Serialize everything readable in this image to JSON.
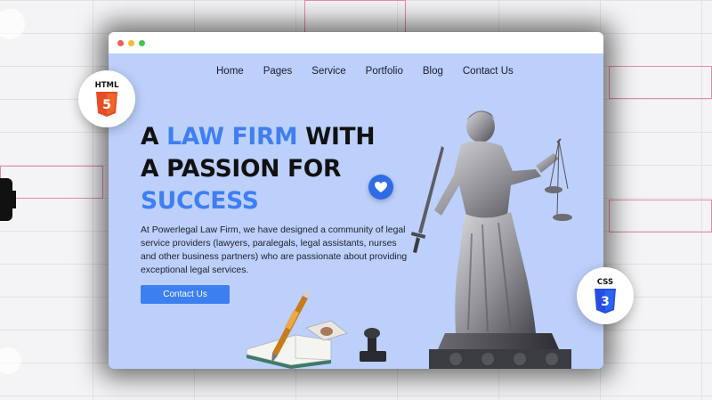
{
  "window": {
    "dots": [
      "close",
      "minimize",
      "maximize"
    ]
  },
  "nav": {
    "items": [
      "Home",
      "Pages",
      "Service",
      "Portfolio",
      "Blog",
      "Contact Us"
    ]
  },
  "hero": {
    "title_part1": "A ",
    "title_accent1": "LAW FIRM",
    "title_part2": " WITH",
    "title_line2": "A PASSION FOR",
    "title_accent2": "SUCCESS",
    "description": "At Powerlegal Law Firm, we have designed a community of legal service providers (lawyers, paralegals, legal assistants, nurses and other business partners) who are passionate about providing exceptional legal services.",
    "cta_label": "Contact Us"
  },
  "badges": {
    "html": "HTML",
    "css": "CSS"
  },
  "icons": [
    "html5-icon",
    "css3-icon",
    "heart-icon",
    "justice-statue-image",
    "pen-icon",
    "stamp-icon"
  ],
  "colors": {
    "accent": "#3f7ef3",
    "hero_bg": "#bcd0fb",
    "button": "#3b7ff0",
    "html5": "#e44d26",
    "css3": "#264de4"
  }
}
